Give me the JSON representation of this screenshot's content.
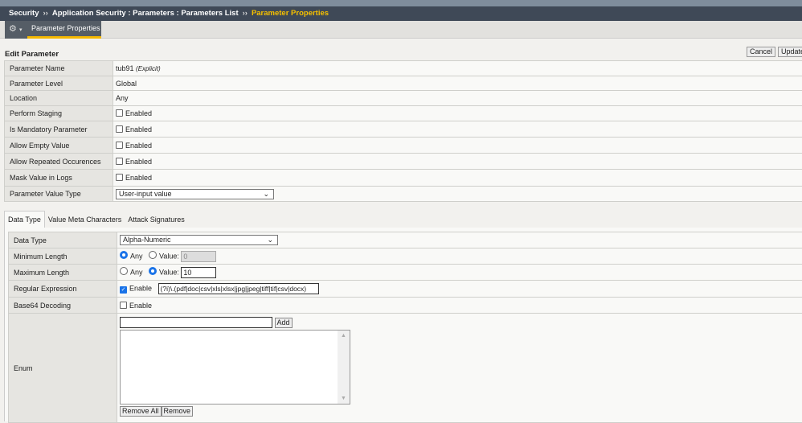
{
  "breadcrumb": {
    "items": [
      "Security",
      "Application Security : Parameters : Parameters List"
    ],
    "current": "Parameter Properties",
    "separator": "››"
  },
  "tabbar": {
    "gear_icon": "gear-icon",
    "active_tab": "Parameter Properties"
  },
  "form": {
    "title": "Edit Parameter",
    "cancel_label": "Cancel",
    "update_label": "Update"
  },
  "params": {
    "name_label": "Parameter Name",
    "name_value": "tub91",
    "name_note": "(Explicit)",
    "level_label": "Parameter Level",
    "level_value": "Global",
    "location_label": "Location",
    "location_value": "Any",
    "staging_label": "Perform Staging",
    "mandatory_label": "Is Mandatory Parameter",
    "empty_label": "Allow Empty Value",
    "repeated_label": "Allow Repeated Occurences",
    "mask_label": "Mask Value in Logs",
    "enabled": "Enabled",
    "value_type_label": "Parameter Value Type",
    "value_type_value": "User-input value"
  },
  "tabs": [
    "Data Type",
    "Value Meta Characters",
    "Attack Signatures"
  ],
  "datatype": {
    "type_label": "Data Type",
    "type_value": "Alpha-Numeric",
    "min_label": "Minimum Length",
    "min_value": "0",
    "max_label": "Maximum Length",
    "max_value": "10",
    "any": "Any",
    "value": "Value:",
    "regex_label": "Regular Expression",
    "enable": "Enable",
    "regex_value": "(?i)\\.(pdf|doc|csv|xls|xlsx|jpg|jpeg|tiff|tif|csv|docx)",
    "b64_label": "Base64 Decoding",
    "enum_label": "Enum",
    "add_label": "Add",
    "remove_all_label": "Remove All",
    "remove_label": "Remove"
  }
}
